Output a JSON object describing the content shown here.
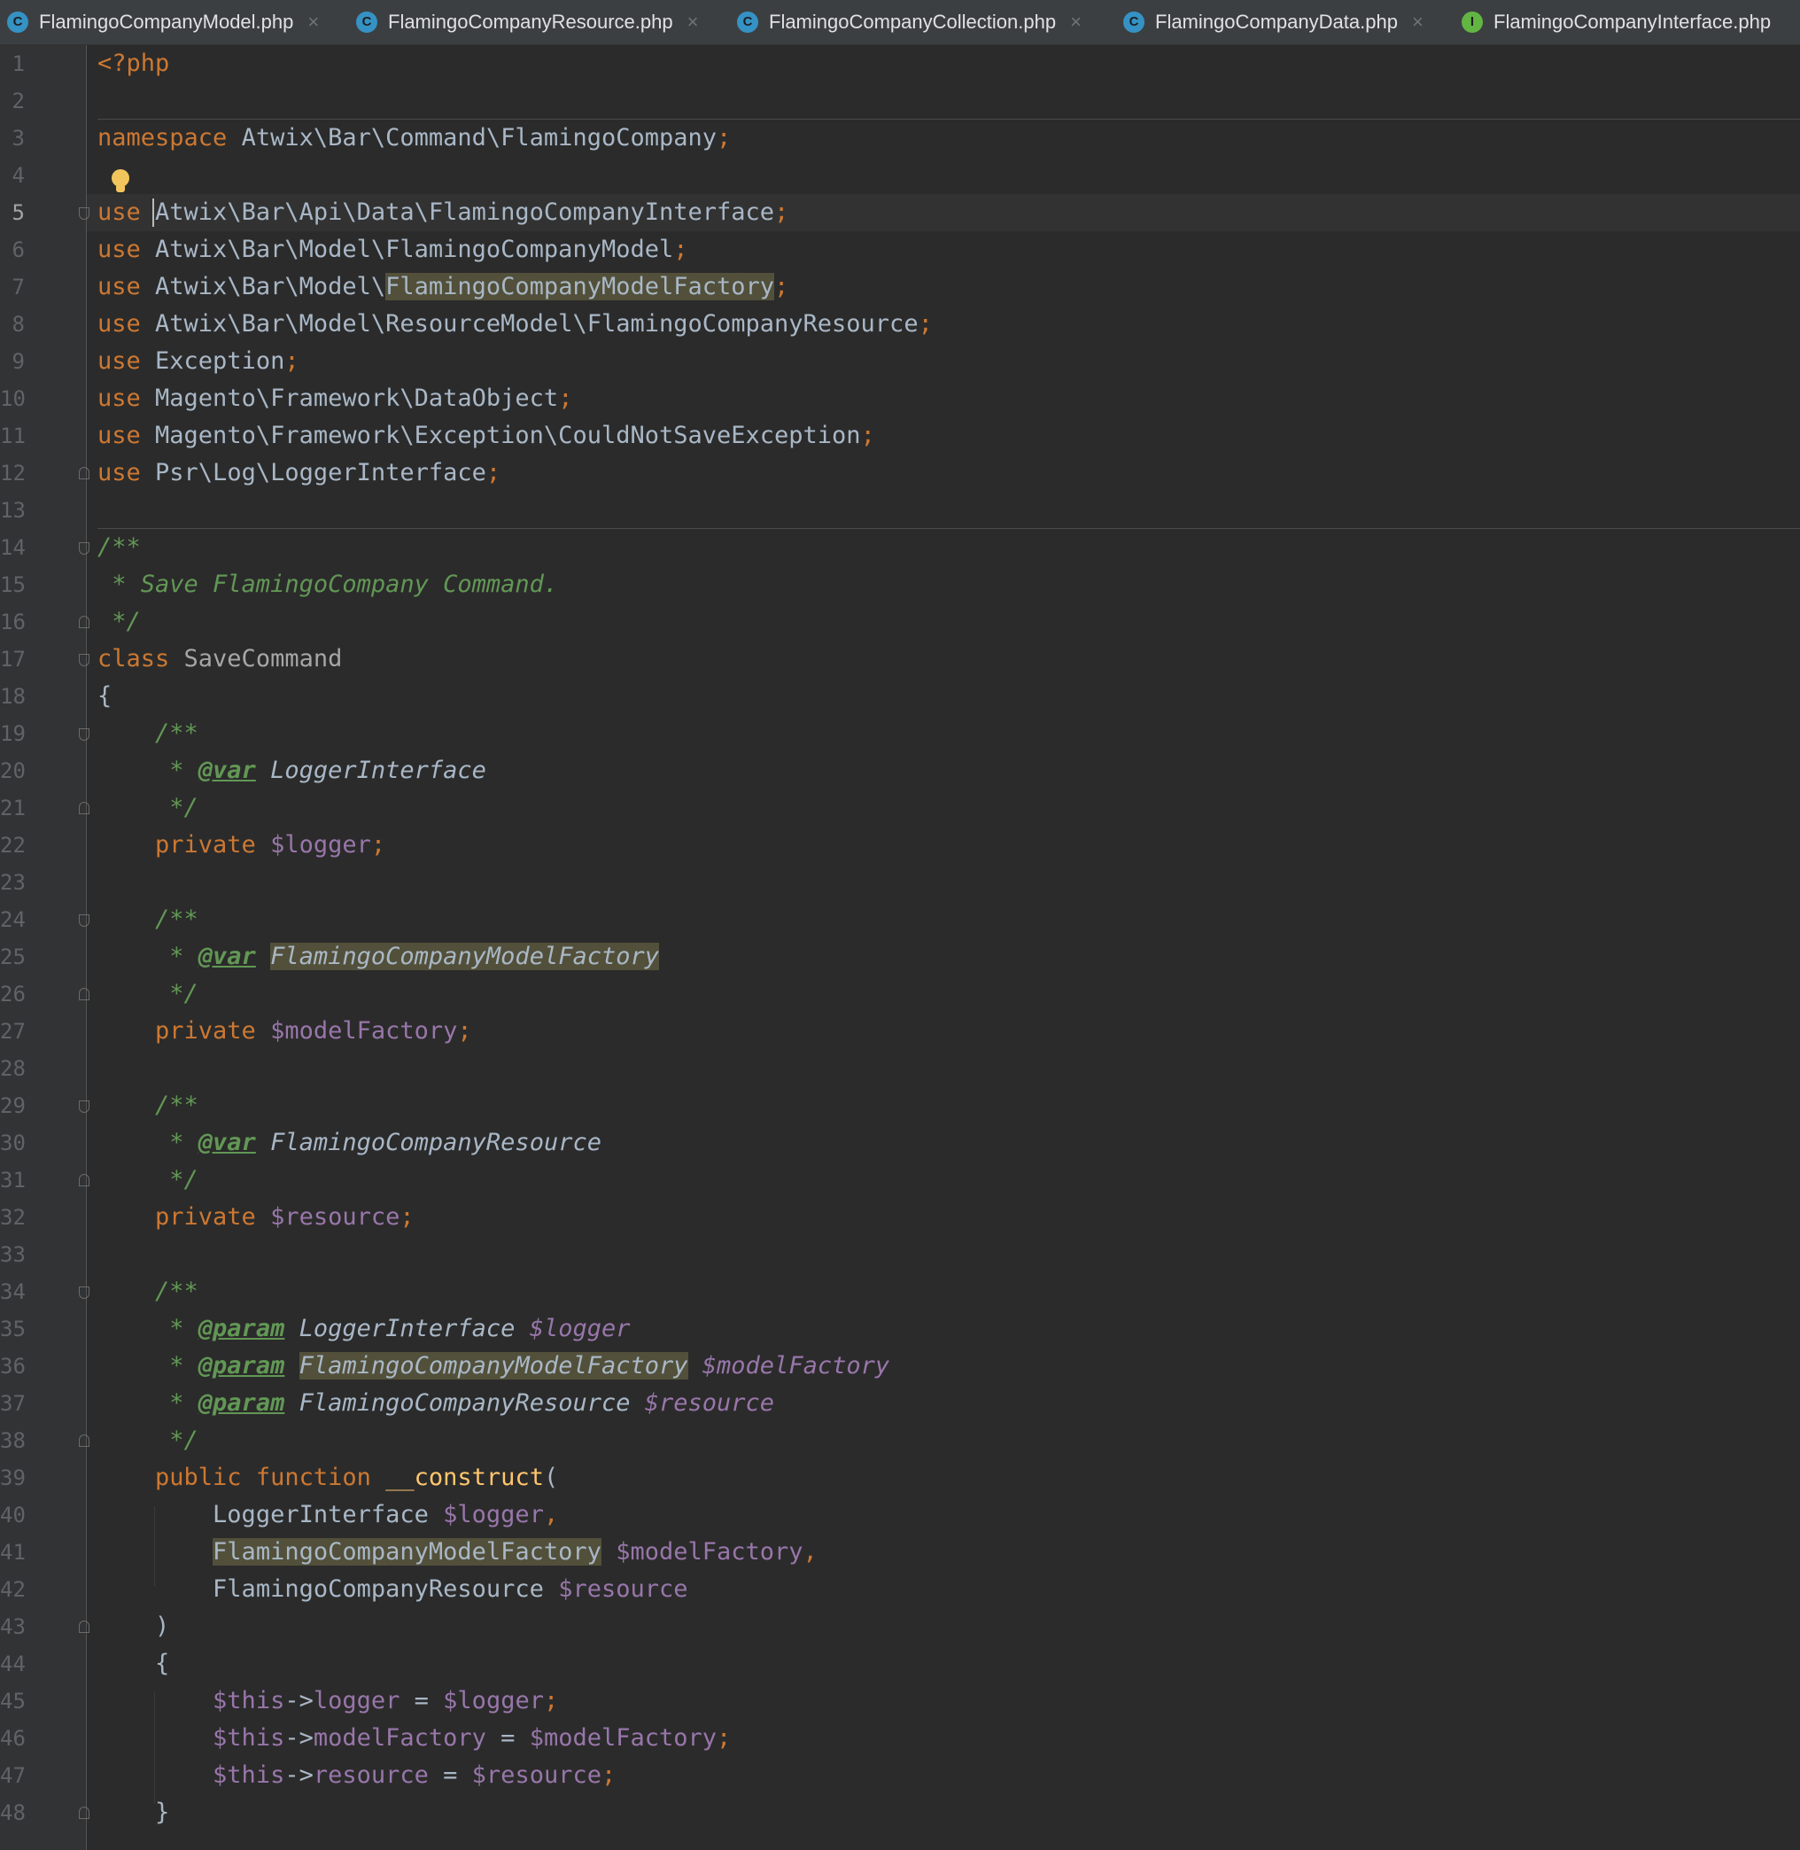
{
  "tabs": [
    {
      "label": "FlamingoCompanyModel.php",
      "icon": "class-icon",
      "icon_letter": "C"
    },
    {
      "label": "FlamingoCompanyResource.php",
      "icon": "class-icon",
      "icon_letter": "C"
    },
    {
      "label": "FlamingoCompanyCollection.php",
      "icon": "class-icon",
      "icon_letter": "C"
    },
    {
      "label": "FlamingoCompanyData.php",
      "icon": "class-icon",
      "icon_letter": "C"
    },
    {
      "label": "FlamingoCompanyInterface.php",
      "icon": "interface-icon",
      "icon_letter": "I"
    }
  ],
  "tab_close": "×",
  "line_numbers": [
    "1",
    "2",
    "3",
    "4",
    "5",
    "6",
    "7",
    "8",
    "9",
    "10",
    "11",
    "12",
    "13",
    "14",
    "15",
    "16",
    "17",
    "18",
    "19",
    "20",
    "21",
    "22",
    "23",
    "24",
    "25",
    "26",
    "27",
    "28",
    "29",
    "30",
    "31",
    "32",
    "33",
    "34",
    "35",
    "36",
    "37",
    "38",
    "39",
    "40",
    "41",
    "42",
    "43",
    "44",
    "45",
    "46",
    "47",
    "48"
  ],
  "current_line": 5,
  "colors": {
    "keyword": "#cc7832",
    "variable": "#9876aa",
    "function": "#ffc66d",
    "doc_comment": "#629755",
    "text": "#a9b7c6",
    "background": "#2b2b2b",
    "highlight": "#52503a"
  },
  "code": {
    "l1": "<?php",
    "l3_kw": "namespace",
    "l3_ns": " Atwix\\Bar\\Command\\FlamingoCompany",
    "semi": ";",
    "use": "use",
    "l5": " Atwix\\Bar\\Api\\Data\\FlamingoCompanyInterface",
    "l6": " Atwix\\Bar\\Model\\FlamingoCompanyModel",
    "l7_a": " Atwix\\Bar\\Model\\",
    "l7_b": "FlamingoCompanyModelFactory",
    "l8": " Atwix\\Bar\\Model\\ResourceModel\\FlamingoCompanyResource",
    "l9": " Exception",
    "l10": " Magento\\Framework\\DataObject",
    "l11": " Magento\\Framework\\Exception\\CouldNotSaveException",
    "l12": " Psr\\Log\\LoggerInterface",
    "l14": "/**",
    "l15": " * Save FlamingoCompany Command.",
    "l16": " */",
    "l17_kw": "class",
    "l17_name": " SaveCommand",
    "l18": "{",
    "doc_open": "    /**",
    "doc_star": "     * ",
    "doc_close": "     */",
    "tag_var": "@var",
    "tag_param": "@param",
    "t_logger_iface": "LoggerInterface",
    "t_model_factory": "FlamingoCompanyModelFactory",
    "t_resource": "FlamingoCompanyResource",
    "private": "    private",
    "v_logger": "$logger",
    "v_model_factory": "$modelFactory",
    "v_resource": "$resource",
    "l39_public": "    public",
    "l39_function": "function",
    "l39_name": "__construct",
    "paren_open": "(",
    "indent2": "        ",
    "comma": ",",
    "l43": "    )",
    "l44": "    {",
    "this": "$this",
    "arrow": "->",
    "p_logger": "logger",
    "p_model_factory": "modelFactory",
    "p_resource": "resource",
    "assign": " = ",
    "l48": "    }"
  }
}
